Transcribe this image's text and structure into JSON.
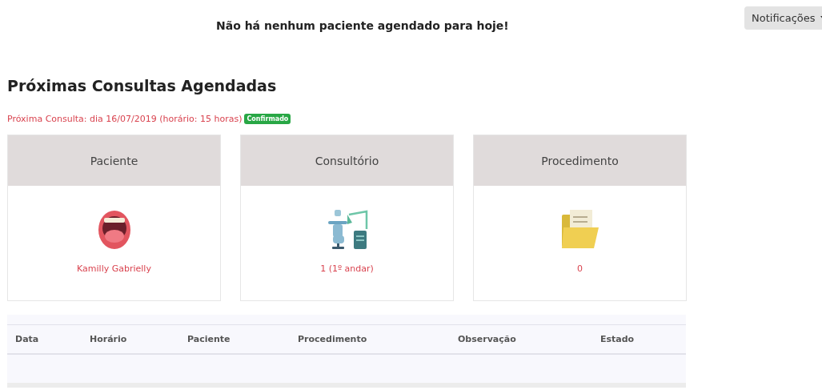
{
  "notice": "Não há nenhum paciente agendado para hoje!",
  "notifications_button": "Notificações",
  "heading": "Próximas Consultas Agendadas",
  "next_appointment": {
    "text": "Próxima Consulta: dia 16/07/2019 (horário: 15 horas)",
    "status": "Confirmado"
  },
  "cards": [
    {
      "title": "Paciente",
      "value": "Kamilly Gabrielly"
    },
    {
      "title": "Consultório",
      "value": "1 (1º andar)"
    },
    {
      "title": "Procedimento",
      "value": "0"
    }
  ],
  "table": {
    "columns": [
      "Data",
      "Horário",
      "Paciente",
      "Procedimento",
      "Observação",
      "Estado"
    ]
  }
}
